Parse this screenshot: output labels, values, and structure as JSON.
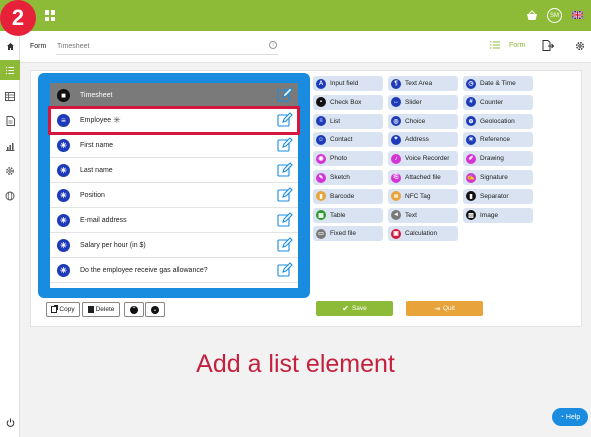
{
  "step_badge": "2",
  "caption": "Add a list element",
  "colors": {
    "accent_green": "#8dbb37",
    "panel_blue": "#1a8ce0",
    "highlight_red": "#d3173e",
    "save_green": "#8dbb37",
    "quit_orange": "#e8a33b"
  },
  "topbar": {
    "user_initials": "SM",
    "icons": [
      "apps-grid-icon",
      "basket-icon",
      "uk-flag-icon"
    ]
  },
  "sidebar": {
    "icons": [
      "home-icon",
      "list-check-icon",
      "table-icon",
      "document-icon",
      "chart-icon",
      "gear-icon",
      "globe-icon",
      "power-icon"
    ],
    "active": "list-check-icon"
  },
  "subheader": {
    "form_label": "Form",
    "form_name_placeholder": "Timesheet",
    "info_icon": "info-icon",
    "form_tab_label": "Form"
  },
  "form_list": {
    "header": "Timesheet",
    "rows": [
      {
        "label": "Employee",
        "icon": "list-icon",
        "selected": true,
        "star": "✳"
      },
      {
        "label": "First name",
        "icon": "asterisk-icon"
      },
      {
        "label": "Last name",
        "icon": "asterisk-icon"
      },
      {
        "label": "Position",
        "icon": "asterisk-icon"
      },
      {
        "label": "E-mail address",
        "icon": "asterisk-icon"
      },
      {
        "label": "Salary per hour (in $)",
        "icon": "asterisk-icon"
      },
      {
        "label": "Do the employee receive gas allowance?",
        "icon": "asterisk-icon"
      }
    ]
  },
  "actions": {
    "copy": "Copy",
    "delete": "Delete"
  },
  "palette": {
    "col1": [
      {
        "label": "Input field",
        "icon": "A",
        "color": "#1d3bb8"
      },
      {
        "label": "Check Box",
        "icon": "▪",
        "color": "#111111"
      },
      {
        "label": "List",
        "icon": "≡",
        "color": "#1d3bb8"
      },
      {
        "label": "Contact",
        "icon": "☺",
        "color": "#1d3bb8"
      },
      {
        "label": "Photo",
        "icon": "◉",
        "color": "#d633d6"
      },
      {
        "label": "Sketch",
        "icon": "✎",
        "color": "#d633d6"
      },
      {
        "label": "Barcode",
        "icon": "▮",
        "color": "#e8a33b"
      },
      {
        "label": "Table",
        "icon": "▦",
        "color": "#2b9a2b"
      },
      {
        "label": "Fixed file",
        "icon": "▭",
        "color": "#7a7a7a"
      }
    ],
    "col2": [
      {
        "label": "Text Area",
        "icon": "¶",
        "color": "#1d3bb8"
      },
      {
        "label": "Slider",
        "icon": "↔",
        "color": "#1d3bb8"
      },
      {
        "label": "Choice",
        "icon": "◎",
        "color": "#1d3bb8"
      },
      {
        "label": "Address",
        "icon": "⌖",
        "color": "#1d3bb8"
      },
      {
        "label": "Voice Recorder",
        "icon": "♪",
        "color": "#d633d6"
      },
      {
        "label": "Attached file",
        "icon": "⎘",
        "color": "#d633d6"
      },
      {
        "label": "NFC Tag",
        "icon": "≋",
        "color": "#e8a33b"
      },
      {
        "label": "Text",
        "icon": "◄",
        "color": "#7a7a7a"
      },
      {
        "label": "Calculation",
        "icon": "▣",
        "color": "#d3173e"
      }
    ],
    "col3": [
      {
        "label": "Date & Time",
        "icon": "◷",
        "color": "#1d3bb8"
      },
      {
        "label": "Counter",
        "icon": "#",
        "color": "#1d3bb8"
      },
      {
        "label": "Geolocation",
        "icon": "⊕",
        "color": "#1d3bb8"
      },
      {
        "label": "Reference",
        "icon": "✳",
        "color": "#1d3bb8"
      },
      {
        "label": "Drawing",
        "icon": "✐",
        "color": "#d633d6"
      },
      {
        "label": "Signature",
        "icon": "✍",
        "color": "#d633d6"
      },
      {
        "label": "Separator",
        "icon": "▮",
        "color": "#111111"
      },
      {
        "label": "Image",
        "icon": "▨",
        "color": "#111111"
      }
    ]
  },
  "footer_buttons": {
    "save": "Save",
    "quit": "Quit"
  },
  "help": {
    "label": "Help"
  }
}
